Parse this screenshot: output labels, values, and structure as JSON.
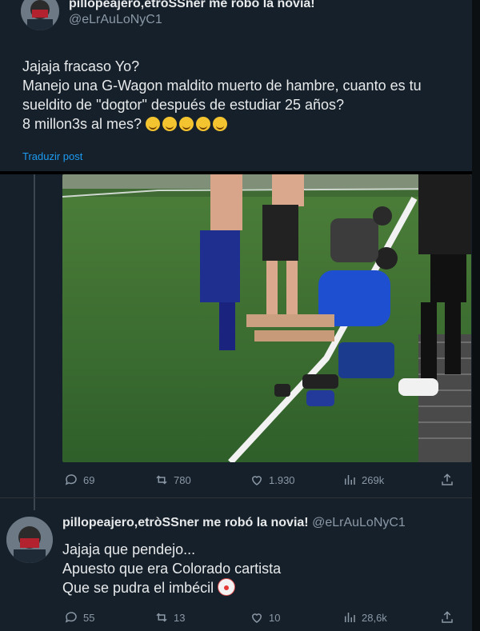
{
  "tweet1": {
    "name": "pillopeajero,etròSSner me robó la novia!",
    "handle": "@eLrAuLoNyC1",
    "lines": [
      "Jajaja fracaso Yo?",
      "Manejo una G-Wagon maldito muerto de hambre, cuanto es tu",
      "sueldito de \"dogtor\" después de estudiar 25 años?",
      "8 millon3s al mes?"
    ],
    "translate_label": "Traduzir post"
  },
  "tweet2": {
    "stats": {
      "replies": "69",
      "retweets": "780",
      "likes": "1.930",
      "views": "269k"
    }
  },
  "tweet3": {
    "name": "pillopeajero,etròSSner me robó la novia!",
    "handle": "@eLrAuLoNyC1",
    "lines": [
      "Jajaja que pendejo...",
      "Apuesto que era Colorado cartista",
      "Que se pudra el imbécil"
    ],
    "stats": {
      "replies": "55",
      "retweets": "13",
      "likes": "10",
      "views": "28,6k"
    }
  },
  "colors": {
    "background": "#15202b",
    "text": "#e7e9ea",
    "muted": "#8b98a5",
    "link": "#1d9bf0"
  },
  "icons": [
    "reply-icon",
    "retweet-icon",
    "like-icon",
    "views-icon",
    "share-icon",
    "laughing-emoji-icon",
    "clown-emoji-icon"
  ]
}
